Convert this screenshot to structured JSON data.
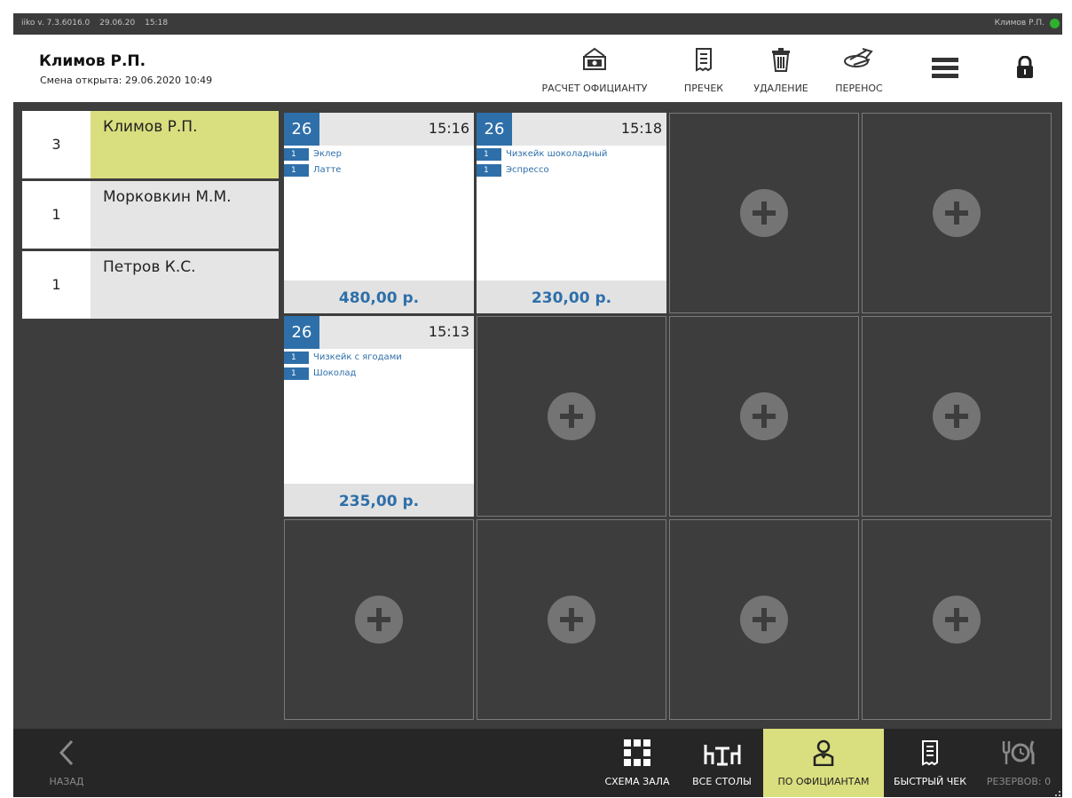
{
  "status_bar": {
    "app_version": "iiko  v. 7.3.6016.0",
    "date": "29.06.20",
    "time": "15:18",
    "user": "Климов Р.П.",
    "online_color": "#2fb02f"
  },
  "header": {
    "user_name": "Климов Р.П.",
    "shift_text": "Смена открыта: 29.06.2020 10:49",
    "buttons": {
      "pay_waiter": "РАСЧЕТ ОФИЦИАНТУ",
      "precheck": "ПРЕЧЕК",
      "delete": "УДАЛЕНИЕ",
      "transfer": "ПЕРЕНОС"
    }
  },
  "waiters": [
    {
      "count": "3",
      "name": "Климов Р.П.",
      "active": true
    },
    {
      "count": "1",
      "name": "Морковкин М.М.",
      "active": false
    },
    {
      "count": "1",
      "name": "Петров К.С.",
      "active": false
    }
  ],
  "orders": [
    {
      "table": "26",
      "time": "15:16",
      "items": [
        {
          "qty": "1",
          "name": "Эклер"
        },
        {
          "qty": "1",
          "name": "Латте"
        }
      ],
      "total": "480,00 р."
    },
    {
      "table": "26",
      "time": "15:18",
      "items": [
        {
          "qty": "1",
          "name": "Чизкейк шоколадный"
        },
        {
          "qty": "1",
          "name": "Эспрессо"
        }
      ],
      "total": "230,00 р."
    },
    {
      "table": "26",
      "time": "15:13",
      "items": [
        {
          "qty": "1",
          "name": "Чизкейк с ягодами"
        },
        {
          "qty": "1",
          "name": "Шоколад"
        }
      ],
      "total": "235,00 р."
    }
  ],
  "bottom_bar": {
    "back": "НАЗАД",
    "hall_scheme": "СХЕМА ЗАЛА",
    "all_tables": "ВСЕ СТОЛЫ",
    "by_waiters": "ПО ОФИЦИАНТАМ",
    "quick_check": "БЫСТРЫЙ ЧЕК",
    "reservations": "РЕЗЕРВОВ: 0"
  },
  "colors": {
    "accent_blue": "#2e6fa9",
    "active_yellow": "#d9de7f",
    "background_dark": "#3d3d3d",
    "bottom_bar": "#262626"
  },
  "icons": {
    "pay_waiter": "money-register-icon",
    "precheck": "receipt-icon",
    "delete": "trash-icon",
    "transfer": "transfer-icon",
    "menu": "hamburger-menu-icon",
    "lock": "lock-icon",
    "back": "chevron-left-icon",
    "hall_scheme": "grid-icon",
    "all_tables": "tables-icon",
    "by_waiters": "waiter-icon",
    "quick_check": "receipt-icon",
    "reservations": "reservation-icon"
  }
}
